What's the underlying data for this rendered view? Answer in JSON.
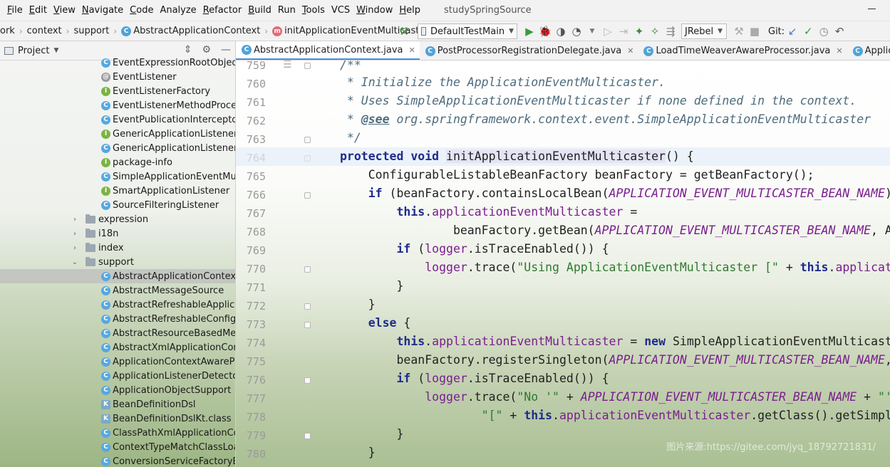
{
  "menu": {
    "items": [
      {
        "u": "F",
        "rest": "ile"
      },
      {
        "u": "E",
        "rest": "dit"
      },
      {
        "u": "V",
        "rest": "iew"
      },
      {
        "u": "N",
        "rest": "avigate"
      },
      {
        "u": "C",
        "rest": "ode"
      },
      {
        "u": "",
        "rest": "Analyze"
      },
      {
        "u": "R",
        "rest": "efactor"
      },
      {
        "u": "B",
        "rest": "uild"
      },
      {
        "u": "",
        "rest": "Run"
      },
      {
        "u": "T",
        "rest": "ools"
      },
      {
        "u": "",
        "rest": "VCS"
      },
      {
        "u": "W",
        "rest": "indow"
      },
      {
        "u": "H",
        "rest": "elp"
      }
    ],
    "window_title": "studySpringSource"
  },
  "breadcrumb": {
    "items": [
      "ork",
      "context",
      "support",
      "AbstractApplicationContext",
      "initApplicationEventMulticaster"
    ]
  },
  "toolbar": {
    "run_config": "DefaultTestMain",
    "jrebel": "JRebel",
    "git_label": "Git:"
  },
  "project": {
    "title": "Project",
    "rows": [
      {
        "icon": "c",
        "label": "EventExpressionRootObject",
        "indent": 1
      },
      {
        "icon": "a",
        "label": "EventListener",
        "indent": 1
      },
      {
        "icon": "i",
        "label": "EventListenerFactory",
        "indent": 1
      },
      {
        "icon": "c",
        "label": "EventListenerMethodProcesso",
        "indent": 1
      },
      {
        "icon": "c",
        "label": "EventPublicationInterceptor",
        "indent": 1
      },
      {
        "icon": "i",
        "label": "GenericApplicationListener",
        "indent": 1
      },
      {
        "icon": "c",
        "label": "GenericApplicationListenerAda",
        "indent": 1
      },
      {
        "icon": "i",
        "label": "package-info",
        "indent": 1
      },
      {
        "icon": "c",
        "label": "SimpleApplicationEventMultica",
        "indent": 1
      },
      {
        "icon": "i",
        "label": "SmartApplicationListener",
        "indent": 1
      },
      {
        "icon": "c",
        "label": "SourceFilteringListener",
        "indent": 1
      },
      {
        "icon": "folder",
        "label": "expression",
        "indent": 0,
        "chev": "›"
      },
      {
        "icon": "folder",
        "label": "i18n",
        "indent": 0,
        "chev": "›"
      },
      {
        "icon": "folder",
        "label": "index",
        "indent": 0,
        "chev": "›"
      },
      {
        "icon": "folder",
        "label": "support",
        "indent": 0,
        "chev": "⌄"
      },
      {
        "icon": "c",
        "label": "AbstractApplicationContext",
        "indent": 1,
        "selected": true
      },
      {
        "icon": "c",
        "label": "AbstractMessageSource",
        "indent": 1
      },
      {
        "icon": "c",
        "label": "AbstractRefreshableApplicatio",
        "indent": 1
      },
      {
        "icon": "c",
        "label": "AbstractRefreshableConfigApp",
        "indent": 1
      },
      {
        "icon": "c",
        "label": "AbstractResourceBasedMessa",
        "indent": 1
      },
      {
        "icon": "c",
        "label": "AbstractXmlApplicationContex",
        "indent": 1
      },
      {
        "icon": "c",
        "label": "ApplicationContextAwareProc",
        "indent": 1
      },
      {
        "icon": "c",
        "label": "ApplicationListenerDetector",
        "indent": 1
      },
      {
        "icon": "c",
        "label": "ApplicationObjectSupport",
        "indent": 1
      },
      {
        "icon": "f",
        "label": "BeanDefinitionDsl",
        "indent": 1
      },
      {
        "icon": "f",
        "label": "BeanDefinitionDslKt.class",
        "indent": 1
      },
      {
        "icon": "c",
        "label": "ClassPathXmlApplicationConte",
        "indent": 1
      },
      {
        "icon": "c",
        "label": "ContextTypeMatchClassLoade",
        "indent": 1
      },
      {
        "icon": "c",
        "label": "ConversionServiceFactoryBear",
        "indent": 1
      }
    ]
  },
  "tabs": [
    {
      "label": "AbstractApplicationContext.java",
      "active": true
    },
    {
      "label": "PostProcessorRegistrationDelegate.java",
      "active": false
    },
    {
      "label": "LoadTimeWeaverAwareProcessor.java",
      "active": false
    },
    {
      "label": "ApplicationListenerI",
      "active": false
    }
  ],
  "editor": {
    "line_numbers": [
      "759",
      "760",
      "761",
      "762",
      "763",
      "764",
      "765",
      "766",
      "767",
      "768",
      "769",
      "770",
      "771",
      "772",
      "773",
      "774",
      "775",
      "776",
      "777",
      "778",
      "779",
      "780"
    ],
    "watermark": "图片来源:https://gitee.com/jyq_18792721831/"
  }
}
